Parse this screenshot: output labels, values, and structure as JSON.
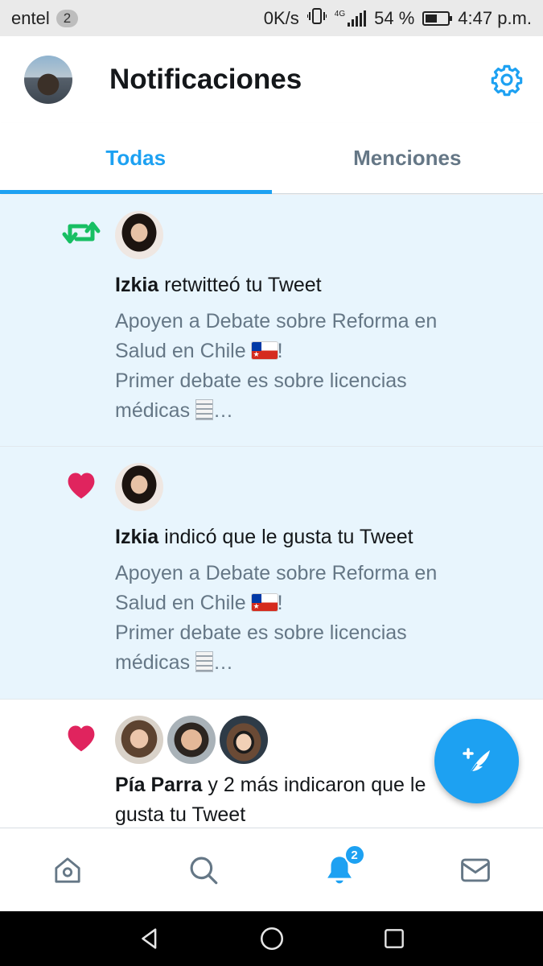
{
  "status_bar": {
    "carrier": "entel",
    "sim_badge": "2",
    "net_speed": "0K/s",
    "network_type": "4G",
    "battery_percent": "54 %",
    "battery_level": 0.54,
    "time": "4:47 p.m."
  },
  "header": {
    "title": "Notificaciones",
    "profile_icon": "avatar",
    "settings_icon": "gear-icon"
  },
  "tabs": [
    {
      "label": "Todas",
      "active": true
    },
    {
      "label": "Menciones",
      "active": false
    }
  ],
  "notifications": [
    {
      "type": "retweet",
      "icon": "retweet-icon",
      "user": "Izkia",
      "action": " retwitteó tu Tweet",
      "tweet_line1": "Apoyen a Debate sobre Reforma en",
      "tweet_line2": "Salud en Chile",
      "tweet_line2_end": "!",
      "tweet_line3": "Primer debate es sobre licencias",
      "tweet_line4": "médicas",
      "tweet_line4_end": "…"
    },
    {
      "type": "like",
      "icon": "heart-icon",
      "user": "Izkia",
      "action": " indicó que le gusta tu Tweet",
      "tweet_line1": "Apoyen a Debate sobre Reforma en",
      "tweet_line2": "Salud en Chile",
      "tweet_line2_end": "!",
      "tweet_line3": "Primer debate es sobre licencias",
      "tweet_line4": "médicas",
      "tweet_line4_end": "…"
    },
    {
      "type": "like",
      "icon": "heart-icon",
      "user": "Pía Parra",
      "action_line1": " y 2 más indicaron que le",
      "action_line2": "gusta tu Tweet"
    }
  ],
  "bottom_nav": [
    {
      "name": "home",
      "icon": "home-icon"
    },
    {
      "name": "search",
      "icon": "search-icon"
    },
    {
      "name": "notifications",
      "icon": "bell-icon",
      "badge": "2",
      "active": true
    },
    {
      "name": "messages",
      "icon": "mail-icon"
    }
  ],
  "colors": {
    "accent": "#1da1f2",
    "retweet": "#17bf63",
    "like": "#e0245e",
    "unread_bg": "#e8f5fd",
    "secondary_text": "#657786"
  }
}
